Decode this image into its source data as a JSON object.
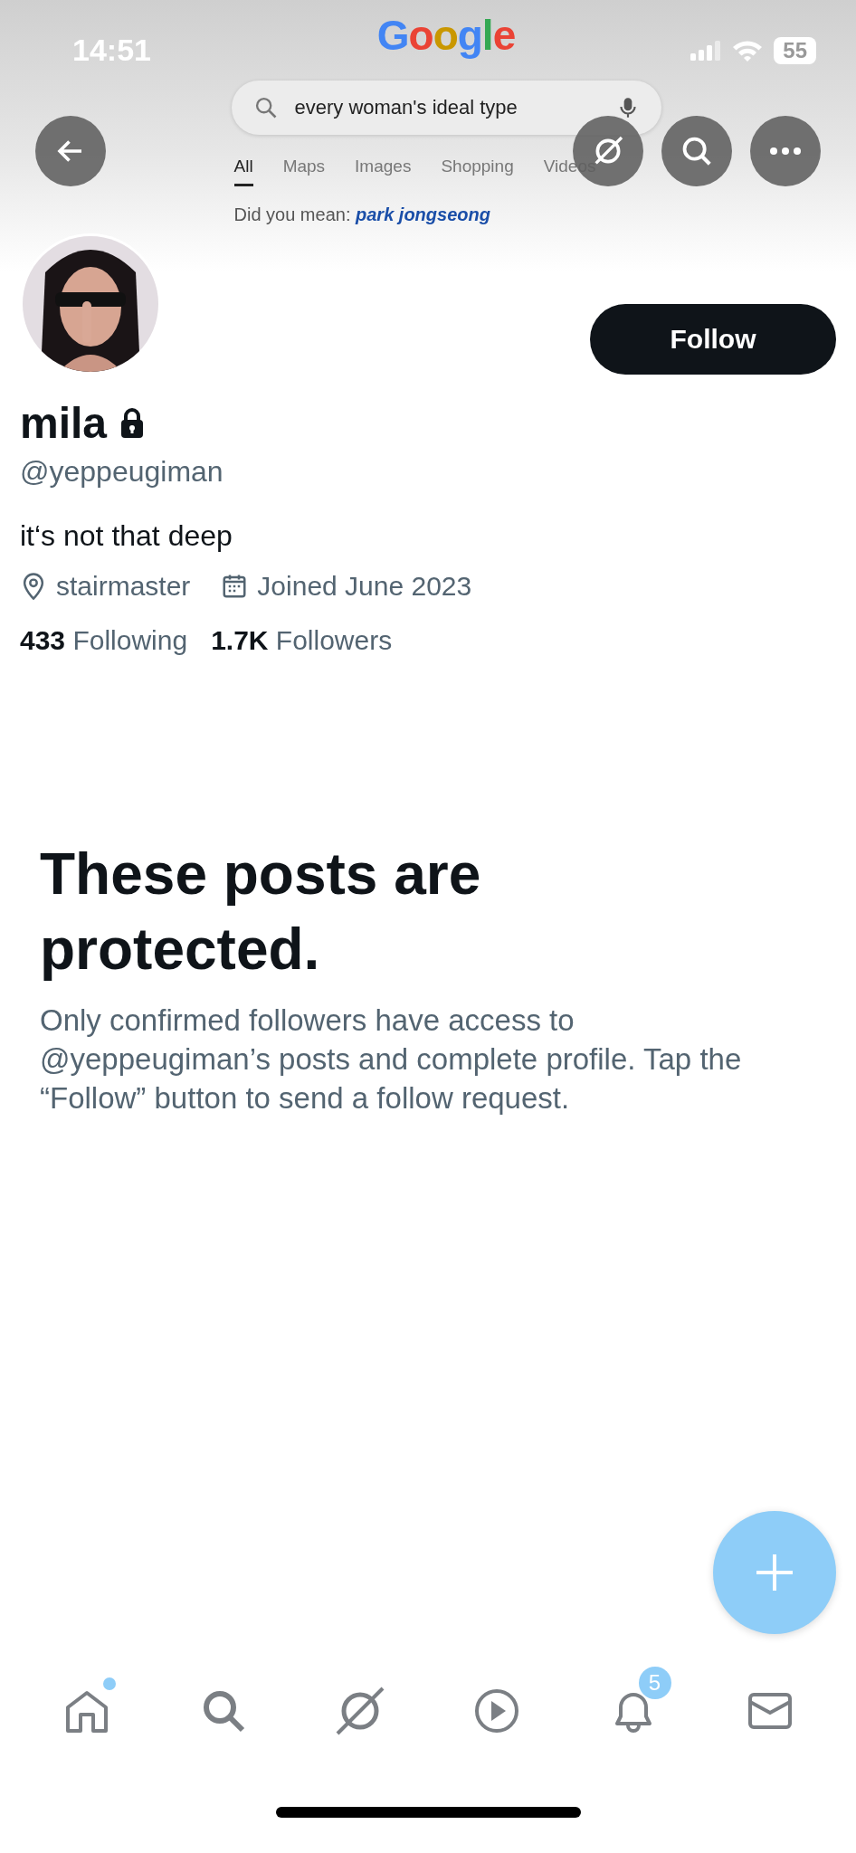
{
  "status_bar": {
    "time": "14:51",
    "battery": "55"
  },
  "banner": {
    "logo": "Google",
    "search_query": "every woman's ideal type",
    "tabs": [
      {
        "label": "All",
        "selected": true
      },
      {
        "label": "Maps",
        "selected": false
      },
      {
        "label": "Images",
        "selected": false
      },
      {
        "label": "Shopping",
        "selected": false
      },
      {
        "label": "Videos",
        "selected": false
      }
    ],
    "suggestion_prefix": "Did you mean:",
    "suggestion": "park jongseong"
  },
  "profile": {
    "name": "mila",
    "locked": true,
    "handle": "@yeppeugiman",
    "bio": "it‘s not that deep",
    "location": "stairmaster",
    "joined": "Joined June 2023",
    "follow_button": "Follow",
    "stats": [
      {
        "count": "433",
        "label": "Following"
      },
      {
        "count": "1.7K",
        "label": "Followers"
      }
    ]
  },
  "protected": {
    "title": "These posts are protected.",
    "body": "Only confirmed followers have access to @yeppeugiman’s posts and complete profile. Tap the “Follow” button to send a follow request."
  },
  "bottom_nav": [
    {
      "kind": "home",
      "dot": true
    },
    {
      "kind": "search"
    },
    {
      "kind": "grok"
    },
    {
      "kind": "video"
    },
    {
      "kind": "notifications",
      "badge": "5"
    },
    {
      "kind": "messages"
    }
  ]
}
